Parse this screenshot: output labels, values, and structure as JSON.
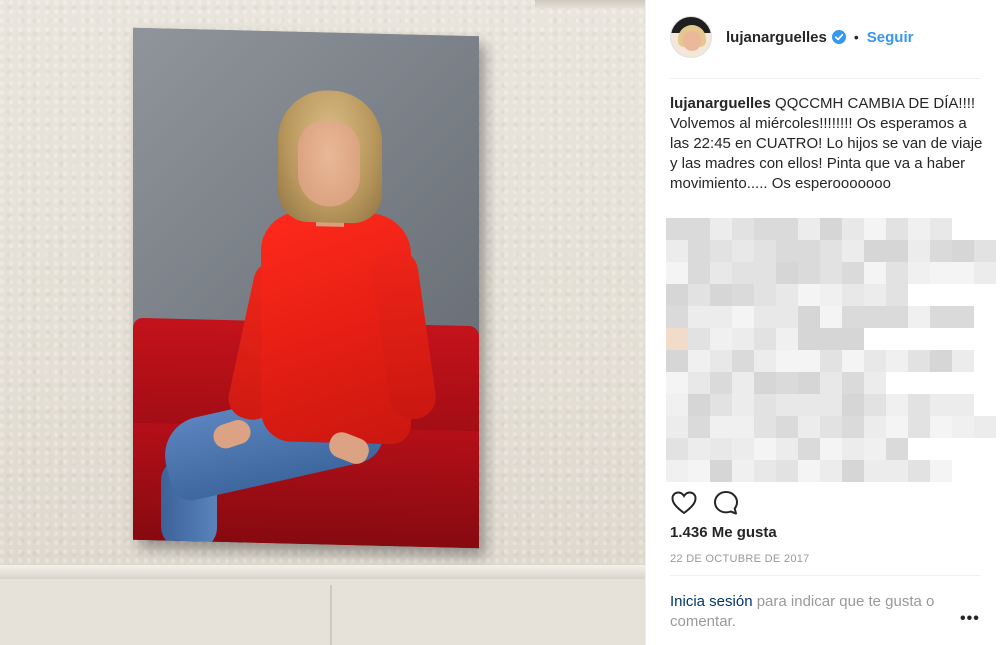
{
  "post": {
    "username": "lujanarguelles",
    "verified": true,
    "header_dot": "•",
    "follow_label": "Seguir",
    "caption_user": "lujanarguelles",
    "caption_text": "QQCCMH CAMBIA DE DÍA!!!! Volvemos al miércoles!!!!!!!! Os esperamos a las 22:45 en CUATRO! Lo hijos se van de viaje y las madres con ellos! Pinta que va a haber movimiento..... Os esperooooooo",
    "likes": "1.436 Me gusta",
    "date": "22 DE OCTUBRE DE 2017",
    "login_link": "Inicia sesión",
    "login_rest": " para indicar que te gusta o comentar.",
    "more_options": "•••"
  },
  "icons": {
    "like": "heart-icon",
    "comment": "comment-icon",
    "verified": "verified-badge-icon"
  },
  "colors": {
    "link_blue": "#3897f0",
    "login_link": "#003569",
    "muted": "#999999",
    "text": "#262626",
    "shirt_red": "#e71f14"
  }
}
